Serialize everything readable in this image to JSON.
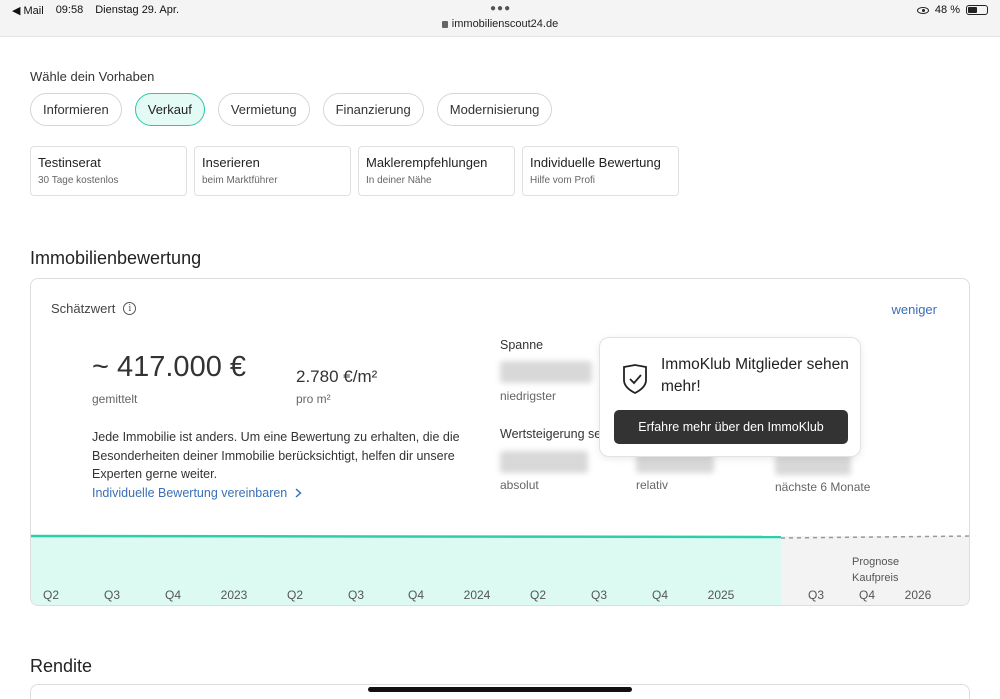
{
  "statusbar": {
    "back_app": "◀ Mail",
    "time": "09:58",
    "date": "Dienstag 29. Apr.",
    "url": "immobilienscout24.de",
    "battery": "48 %"
  },
  "vorhaben": {
    "label": "Wähle dein Vorhaben",
    "pills": [
      "Informieren",
      "Verkauf",
      "Vermietung",
      "Finanzierung",
      "Modernisierung"
    ],
    "active": "Verkauf"
  },
  "cards": [
    {
      "title": "Testinserat",
      "sub": "30 Tage kostenlos"
    },
    {
      "title": "Inserieren",
      "sub": "beim Marktführer"
    },
    {
      "title": "Maklerempfehlungen",
      "sub": "In deiner Nähe"
    },
    {
      "title": "Individuelle Bewertung",
      "sub": "Hilfe vom Profi"
    }
  ],
  "bewertung": {
    "heading": "Immobilienbewertung",
    "schaetzwert": "Schätzwert",
    "toggle": "weniger",
    "price": "~ 417.000 €",
    "price_label": "gemittelt",
    "sqm_price": "2.780 €/m²",
    "sqm_label": "pro m²",
    "description": "Jede Immobilie ist anders. Um eine Bewertung zu erhalten, die die Besonderheiten deiner Immobilie berücksichtigt, helfen dir unsere Experten gerne weiter.",
    "link": "Individuelle Bewertung vereinbaren",
    "spanne": "Spanne",
    "niedrigster": "niedrigster",
    "wertsteigerung": "Wertsteigerung se",
    "absolut": "absolut",
    "relativ": "relativ",
    "naechste": "nächste 6 Monate"
  },
  "popup": {
    "title": "ImmoKlub Mitglieder sehen mehr!",
    "button": "Erfahre mehr über den ImmoKlub"
  },
  "chart_data": {
    "type": "area",
    "x": [
      "Q2",
      "Q3",
      "Q4",
      "2023",
      "Q2",
      "Q3",
      "Q4",
      "2024",
      "Q2",
      "Q3",
      "Q4",
      "2025",
      "Q3",
      "Q4",
      "2026"
    ],
    "forecast_label": [
      "Prognose",
      "Kaufpreis"
    ],
    "colors": {
      "history": "#2ccfac",
      "history_fill": "#dcfaf2",
      "forecast_fill": "#f3f3f3",
      "forecast_line": "#999999"
    }
  },
  "rendite": {
    "heading": "Rendite"
  }
}
